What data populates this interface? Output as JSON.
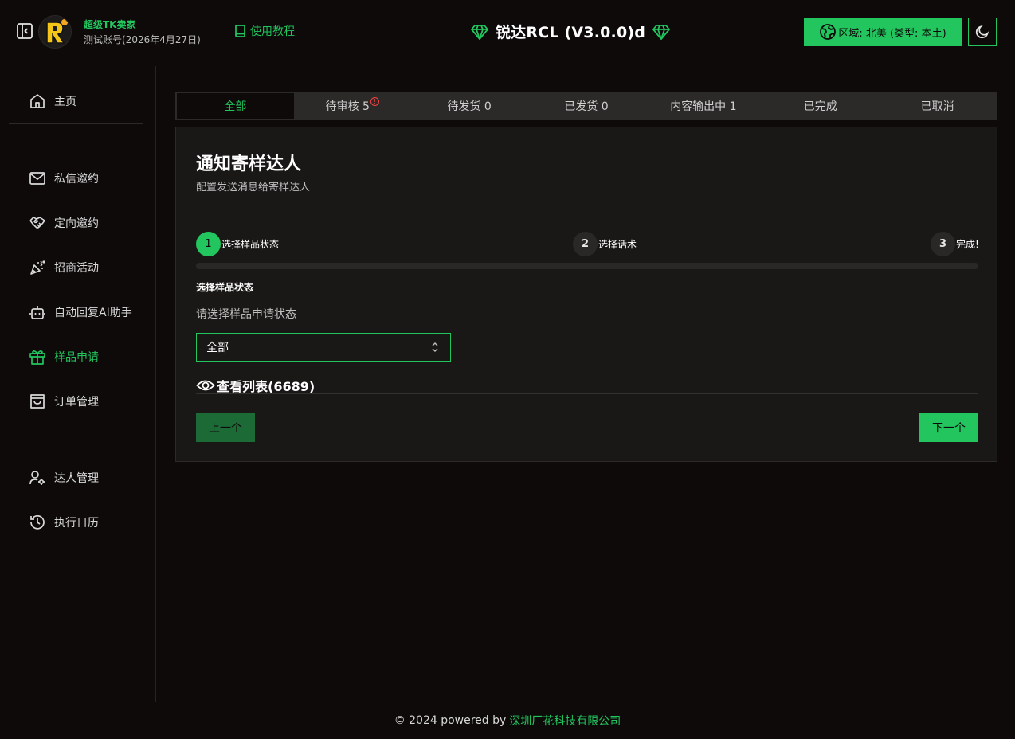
{
  "header": {
    "account_name": "超级TK卖家",
    "account_sub": "测试账号(2026年4月27日)",
    "tutorial_label": "使用教程",
    "brand_title": "锐达RCL (V3.0.0)d",
    "region_label": "区域: 北美 (类型: 本土)",
    "accent_color": "#22c55e"
  },
  "sidebar": {
    "items": [
      {
        "label": "主页",
        "icon": "home-icon"
      },
      {
        "label": "私信邀约",
        "icon": "mail-icon"
      },
      {
        "label": "定向邀约",
        "icon": "handshake-icon"
      },
      {
        "label": "招商活动",
        "icon": "party-popper-icon"
      },
      {
        "label": "自动回复AI助手",
        "icon": "bot-icon"
      },
      {
        "label": "样品申请",
        "icon": "gift-icon",
        "active": true
      },
      {
        "label": "订单管理",
        "icon": "shopping-bag-icon"
      },
      {
        "label": "达人管理",
        "icon": "user-cog-icon"
      },
      {
        "label": "执行日历",
        "icon": "history-icon"
      }
    ]
  },
  "tabs": [
    {
      "label": "全部",
      "active": true
    },
    {
      "label": "待审核 5",
      "alert": "!"
    },
    {
      "label": "待发货 0"
    },
    {
      "label": "已发货 0"
    },
    {
      "label": "内容输出中 1"
    },
    {
      "label": "已完成"
    },
    {
      "label": "已取消"
    }
  ],
  "card": {
    "title": "通知寄样达人",
    "subtitle": "配置发送消息给寄样达人",
    "steps": [
      {
        "number": "1",
        "label": "选择样品状态"
      },
      {
        "number": "2",
        "label": "选择话术"
      },
      {
        "number": "3",
        "label": "完成!"
      }
    ],
    "section_label": "选择样品状态",
    "helper_text": "请选择样品申请状态",
    "select_value": "全部",
    "view_list_label": "查看列表(6689)",
    "prev_label": "上一个",
    "next_label": "下一个"
  },
  "footer": {
    "text": "© 2024 powered by",
    "company": "深圳厂花科技有限公司"
  }
}
